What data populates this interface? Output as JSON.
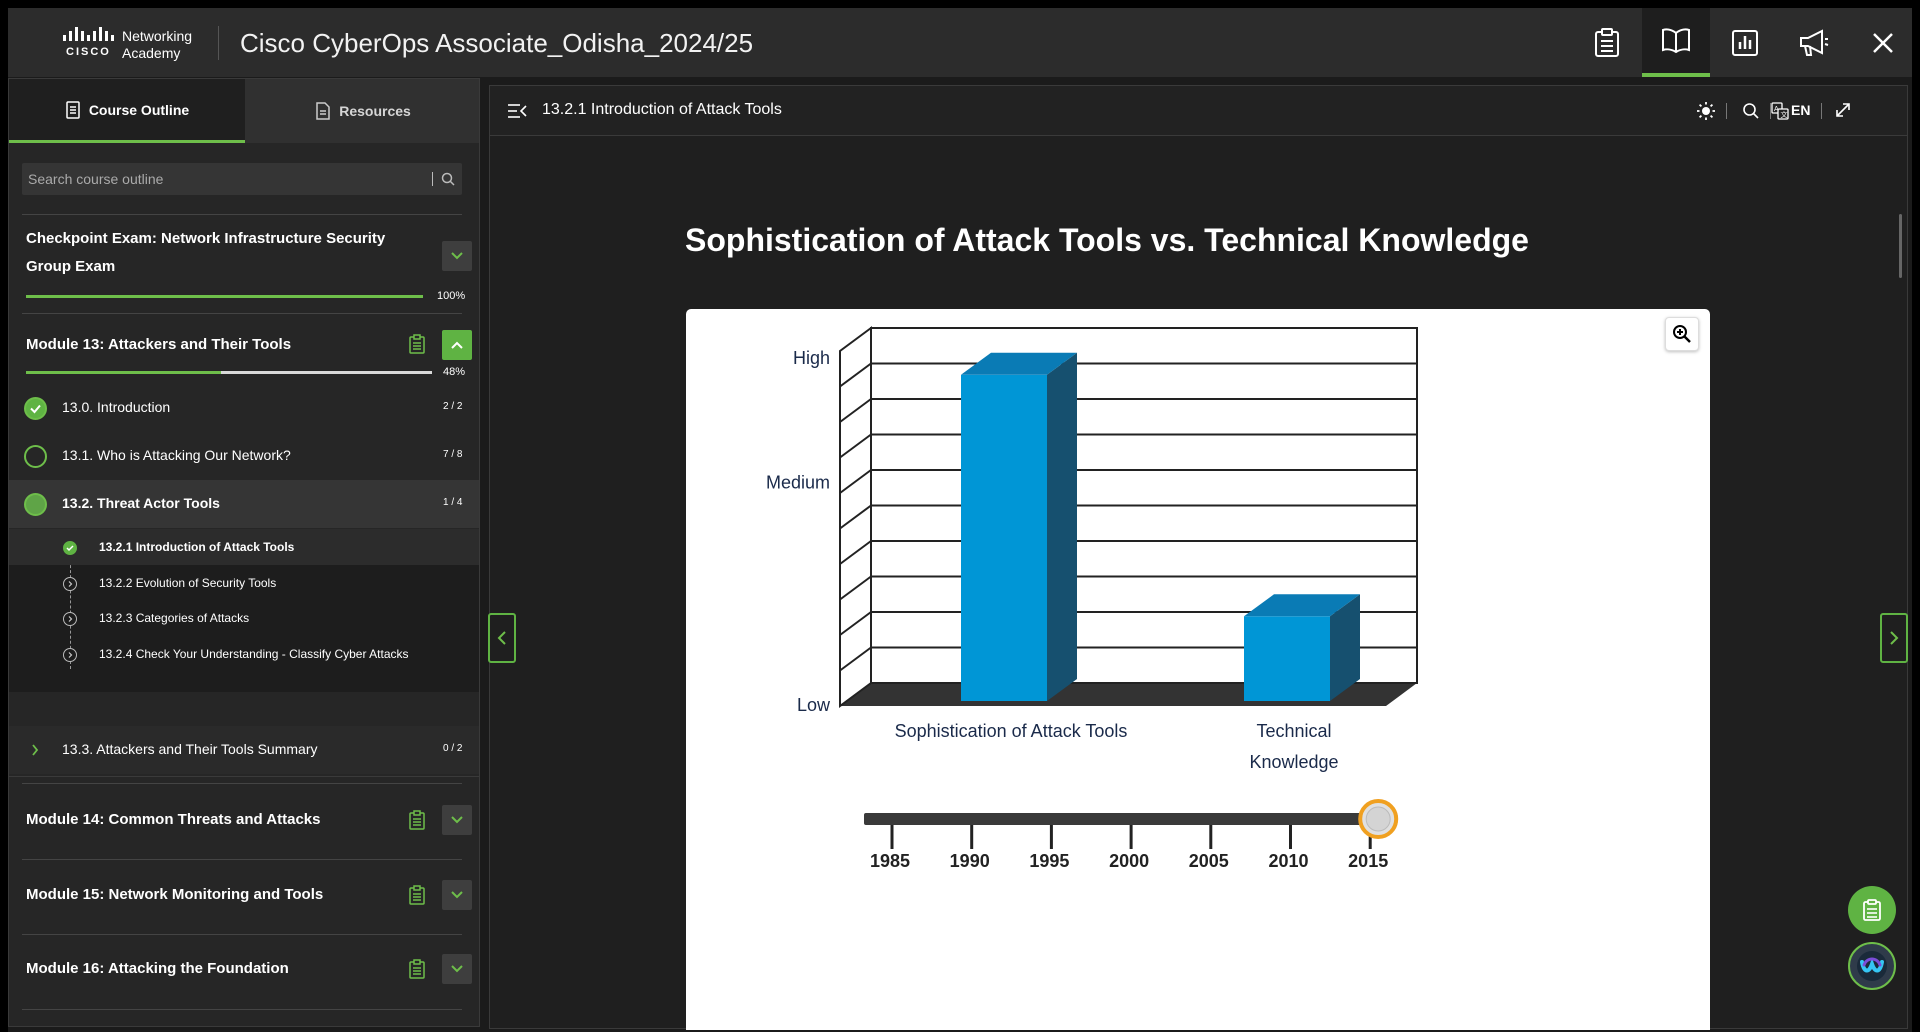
{
  "header": {
    "brand_line1": "Networking",
    "brand_line2": "Academy",
    "brand_cisco": "CISCO",
    "title": "Cisco CyberOps Associate_Odisha_2024/25"
  },
  "sidebar": {
    "tabs": [
      {
        "label": "Course Outline"
      },
      {
        "label": "Resources"
      }
    ],
    "search_placeholder": "Search course outline",
    "checkpoint": {
      "title": "Checkpoint Exam: Network Infrastructure Security Group Exam",
      "progress_pct": 100,
      "progress_label": "100%"
    },
    "module13": {
      "title": "Module 13: Attackers and Their Tools",
      "progress_pct": 48,
      "progress_label": "48%",
      "topics": [
        {
          "label": "13.0. Introduction",
          "count": "2 / 2",
          "state": "done"
        },
        {
          "label": "13.1. Who is Attacking Our Network?",
          "count": "7 / 8",
          "state": "open"
        },
        {
          "label": "13.2. Threat Actor Tools",
          "count": "1 / 4",
          "state": "current"
        },
        {
          "label": "13.3. Attackers and Their Tools Summary",
          "count": "0 / 2",
          "state": "collapsed"
        }
      ],
      "subtopics": [
        {
          "label": "13.2.1 Introduction of Attack Tools",
          "state": "done"
        },
        {
          "label": "13.2.2 Evolution of Security Tools",
          "state": "todo"
        },
        {
          "label": "13.2.3 Categories of Attacks",
          "state": "todo"
        },
        {
          "label": "13.2.4 Check Your Understanding - Classify Cyber Attacks",
          "state": "todo"
        }
      ]
    },
    "modules": [
      {
        "title": "Module 14: Common Threats and Attacks"
      },
      {
        "title": "Module 15: Network Monitoring and Tools"
      },
      {
        "title": "Module 16: Attacking the Foundation"
      }
    ]
  },
  "content": {
    "breadcrumb": "13.2.1 Introduction of Attack Tools",
    "language": "EN",
    "page_title": "Sophistication of Attack Tools vs. Technical Knowledge"
  },
  "colors": {
    "accent": "#6ebe4a",
    "bar_front": "#0096d6",
    "bar_side": "#16506f",
    "bar_top": "#0a7bb5",
    "axis_text": "#1a2a4a"
  },
  "icons": {
    "header": [
      "clipboard-icon",
      "book-icon",
      "chart-icon",
      "megaphone-icon",
      "close-icon"
    ],
    "content_head": [
      "collapse-menu-icon",
      "brightness-icon",
      "search-icon",
      "translate-icon",
      "expand-icon"
    ]
  },
  "chart_data": {
    "type": "bar",
    "title": "",
    "categories": [
      "Sophistication of Attack Tools",
      "Technical Knowledge"
    ],
    "category_lines": [
      [
        "Sophistication of Attack Tools"
      ],
      [
        "Technical",
        "Knowledge"
      ]
    ],
    "values": [
      0.96,
      0.26
    ],
    "y_tick_labels": [
      "Low",
      "Medium",
      "High"
    ],
    "y_tick_values": [
      0,
      0.5,
      0.95
    ],
    "ylim": [
      0,
      1
    ],
    "grid": true,
    "slider": {
      "years": [
        "1985",
        "1990",
        "1995",
        "2000",
        "2005",
        "2010",
        "2015"
      ],
      "selected": "2015"
    }
  }
}
